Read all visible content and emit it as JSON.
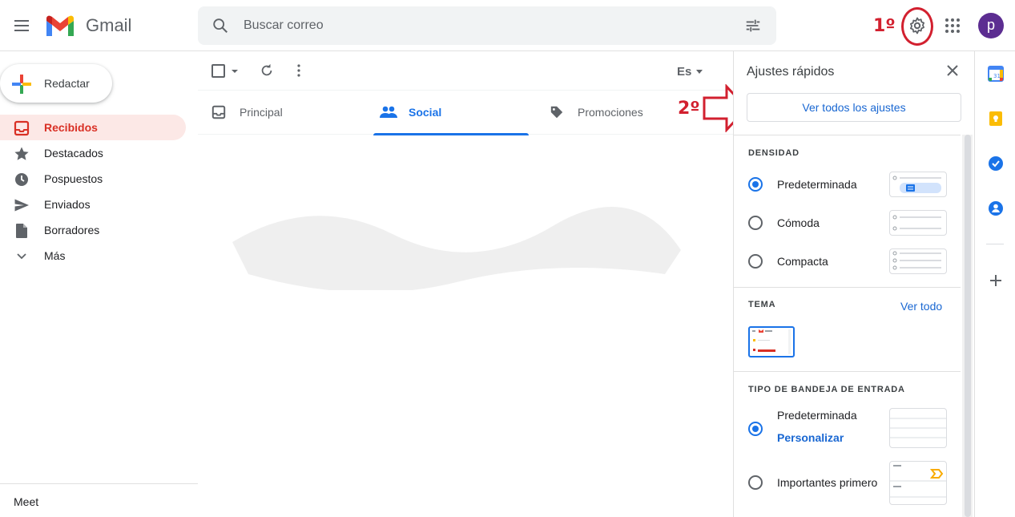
{
  "header": {
    "app_name": "Gmail",
    "search_placeholder": "Buscar correo",
    "avatar_letter": "p",
    "annotation_step1": "1º"
  },
  "compose": {
    "label": "Redactar"
  },
  "sidebar": {
    "items": [
      {
        "label": "Recibidos",
        "icon": "inbox-icon",
        "active": true
      },
      {
        "label": "Destacados",
        "icon": "star-icon"
      },
      {
        "label": "Pospuestos",
        "icon": "clock-icon"
      },
      {
        "label": "Enviados",
        "icon": "send-icon"
      },
      {
        "label": "Borradores",
        "icon": "draft-icon"
      },
      {
        "label": "Más",
        "icon": "chevron-down-icon"
      }
    ],
    "meet_label": "Meet"
  },
  "toolbar": {
    "language_label": "Es"
  },
  "tabs": [
    {
      "label": "Principal",
      "icon": "inbox-tab-icon"
    },
    {
      "label": "Social",
      "icon": "people-icon",
      "active": true
    },
    {
      "label": "Promociones",
      "icon": "tag-icon"
    }
  ],
  "annotation_step2": "2º",
  "quick_settings": {
    "title": "Ajustes rápidos",
    "see_all_button": "Ver todos los ajustes",
    "density": {
      "heading": "DENSIDAD",
      "options": [
        "Predeterminada",
        "Cómoda",
        "Compacta"
      ],
      "selected": "Predeterminada"
    },
    "theme": {
      "heading": "TEMA",
      "view_all": "Ver todo"
    },
    "inbox_type": {
      "heading": "TIPO DE BANDEJA DE ENTRADA",
      "options": [
        "Predeterminada",
        "Importantes primero"
      ],
      "selected": "Predeterminada",
      "customize": "Personalizar"
    }
  },
  "colors": {
    "accent": "#1a73e8",
    "active_nav": "#d93025",
    "annotation": "#d2202f"
  }
}
